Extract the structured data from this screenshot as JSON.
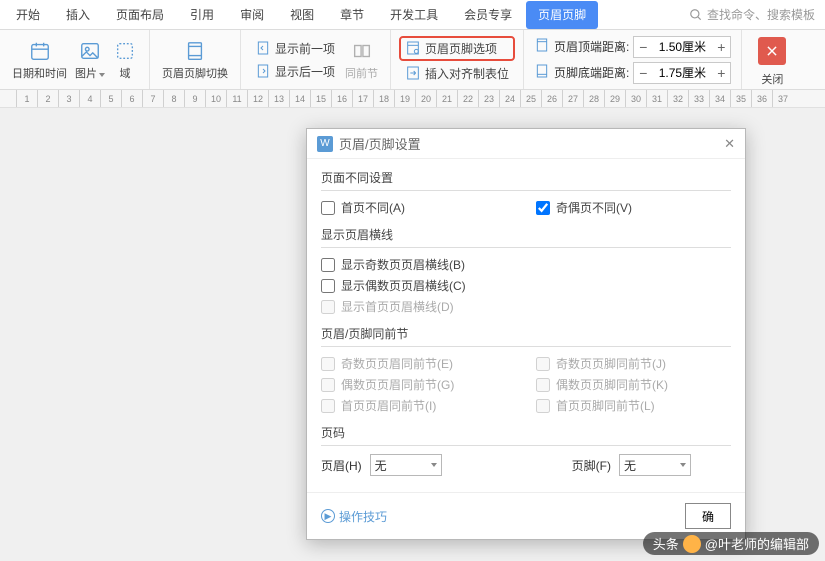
{
  "tabs": {
    "start": "开始",
    "insert": "插入",
    "layout": "页面布局",
    "ref": "引用",
    "review": "审阅",
    "view": "视图",
    "chapter": "章节",
    "dev": "开发工具",
    "vip": "会员专享",
    "hf": "页眉页脚"
  },
  "search_placeholder": "查找命令、搜索模板",
  "ribbon": {
    "datetime": "日期和时间",
    "picture": "图片",
    "field": "域",
    "hfswitch": "页眉页脚切换",
    "show_prev": "显示前一项",
    "show_next": "显示后一项",
    "same_prev": "同前节",
    "hf_options": "页眉页脚选项",
    "insert_align": "插入对齐制表位",
    "header_dist": "页眉顶端距离:",
    "footer_dist": "页脚底端距离:",
    "header_val": "1.50厘米",
    "footer_val": "1.75厘米",
    "close": "关闭"
  },
  "ruler": [
    "1",
    "2",
    "3",
    "4",
    "5",
    "6",
    "7",
    "8",
    "9",
    "10",
    "11",
    "12",
    "13",
    "14",
    "15",
    "16",
    "17",
    "18",
    "19",
    "20",
    "21",
    "22",
    "23",
    "24",
    "25",
    "26",
    "27",
    "28",
    "29",
    "30",
    "31",
    "32",
    "33",
    "34",
    "35",
    "36",
    "37"
  ],
  "dialog": {
    "title": "页眉/页脚设置",
    "sect1": "页面不同设置",
    "first_diff": "首页不同(A)",
    "oddeven_diff": "奇偶页不同(V)",
    "sect2": "显示页眉横线",
    "odd_line": "显示奇数页页眉横线(B)",
    "even_line": "显示偶数页页眉横线(C)",
    "first_line": "显示首页页眉横线(D)",
    "sect3": "页眉/页脚同前节",
    "odd_h": "奇数页页眉同前节(E)",
    "odd_f": "奇数页页脚同前节(J)",
    "even_h": "偶数页页眉同前节(G)",
    "even_f": "偶数页页脚同前节(K)",
    "first_h": "首页页眉同前节(I)",
    "first_f": "首页页脚同前节(L)",
    "sect4": "页码",
    "pn_header": "页眉(H)",
    "pn_footer": "页脚(F)",
    "pn_none": "无",
    "tips": "操作技巧",
    "ok": "确",
    "watermark_src": "头条",
    "watermark_author": "@叶老师的编辑部"
  }
}
